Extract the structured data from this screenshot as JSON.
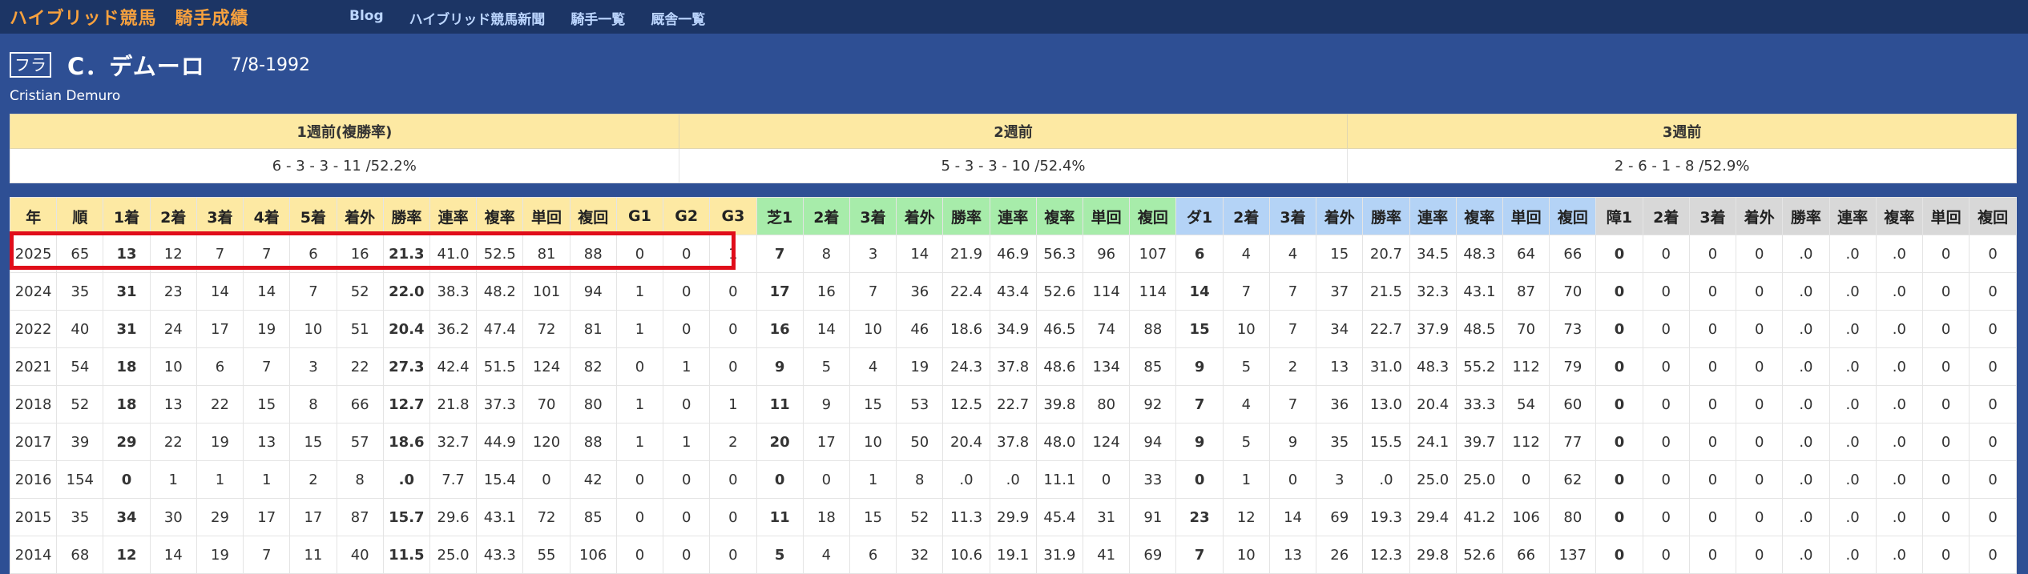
{
  "nav": {
    "site_title": "ハイブリッド競馬　騎手成績",
    "links": [
      "Blog",
      "ハイブリッド競馬新聞",
      "騎手一覧",
      "厩舎一覧"
    ]
  },
  "jockey": {
    "badge": "フラ",
    "name": "C．デムーロ",
    "date": "7/8-1992",
    "english_name": "Cristian Demuro"
  },
  "recent_weeks": {
    "headers": [
      "1週前(複勝率)",
      "2週前",
      "3週前"
    ],
    "values": [
      "6 - 3 - 3 - 11 /52.2%",
      "5 - 3 - 3 - 10 /52.4%",
      "2 - 6 - 1 - 8 /52.9%"
    ]
  },
  "stats_table": {
    "headers": [
      "年",
      "順",
      "1着",
      "2着",
      "3着",
      "4着",
      "5着",
      "着外",
      "勝率",
      "連率",
      "複率",
      "単回",
      "複回",
      "G1",
      "G2",
      "G3",
      "芝1",
      "2着",
      "3着",
      "着外",
      "勝率",
      "連率",
      "複率",
      "単回",
      "複回",
      "ダ1",
      "2着",
      "3着",
      "着外",
      "勝率",
      "連率",
      "複率",
      "単回",
      "複回",
      "障1",
      "2着",
      "3着",
      "着外",
      "勝率",
      "連率",
      "複率",
      "単回",
      "複回"
    ],
    "rows": [
      [
        "2025",
        "65",
        "13",
        "12",
        "7",
        "7",
        "6",
        "16",
        "21.3",
        "41.0",
        "52.5",
        "81",
        "88",
        "0",
        "0",
        "1",
        "7",
        "8",
        "3",
        "14",
        "21.9",
        "46.9",
        "56.3",
        "96",
        "107",
        "6",
        "4",
        "4",
        "15",
        "20.7",
        "34.5",
        "48.3",
        "64",
        "66",
        "0",
        "0",
        "0",
        "0",
        ".0",
        ".0",
        ".0",
        "0",
        "0"
      ],
      [
        "2024",
        "35",
        "31",
        "23",
        "14",
        "14",
        "7",
        "52",
        "22.0",
        "38.3",
        "48.2",
        "101",
        "94",
        "1",
        "0",
        "0",
        "17",
        "16",
        "7",
        "36",
        "22.4",
        "43.4",
        "52.6",
        "114",
        "114",
        "14",
        "7",
        "7",
        "37",
        "21.5",
        "32.3",
        "43.1",
        "87",
        "70",
        "0",
        "0",
        "0",
        "0",
        ".0",
        ".0",
        ".0",
        "0",
        "0"
      ],
      [
        "2022",
        "40",
        "31",
        "24",
        "17",
        "19",
        "10",
        "51",
        "20.4",
        "36.2",
        "47.4",
        "72",
        "81",
        "1",
        "0",
        "0",
        "16",
        "14",
        "10",
        "46",
        "18.6",
        "34.9",
        "46.5",
        "74",
        "88",
        "15",
        "10",
        "7",
        "34",
        "22.7",
        "37.9",
        "48.5",
        "70",
        "73",
        "0",
        "0",
        "0",
        "0",
        ".0",
        ".0",
        ".0",
        "0",
        "0"
      ],
      [
        "2021",
        "54",
        "18",
        "10",
        "6",
        "7",
        "3",
        "22",
        "27.3",
        "42.4",
        "51.5",
        "124",
        "82",
        "0",
        "1",
        "0",
        "9",
        "5",
        "4",
        "19",
        "24.3",
        "37.8",
        "48.6",
        "134",
        "85",
        "9",
        "5",
        "2",
        "13",
        "31.0",
        "48.3",
        "55.2",
        "112",
        "79",
        "0",
        "0",
        "0",
        "0",
        ".0",
        ".0",
        ".0",
        "0",
        "0"
      ],
      [
        "2018",
        "52",
        "18",
        "13",
        "22",
        "15",
        "8",
        "66",
        "12.7",
        "21.8",
        "37.3",
        "70",
        "80",
        "1",
        "0",
        "1",
        "11",
        "9",
        "15",
        "53",
        "12.5",
        "22.7",
        "39.8",
        "80",
        "92",
        "7",
        "4",
        "7",
        "36",
        "13.0",
        "20.4",
        "33.3",
        "54",
        "60",
        "0",
        "0",
        "0",
        "0",
        ".0",
        ".0",
        ".0",
        "0",
        "0"
      ],
      [
        "2017",
        "39",
        "29",
        "22",
        "19",
        "13",
        "15",
        "57",
        "18.6",
        "32.7",
        "44.9",
        "120",
        "88",
        "1",
        "1",
        "2",
        "20",
        "17",
        "10",
        "50",
        "20.4",
        "37.8",
        "48.0",
        "124",
        "94",
        "9",
        "5",
        "9",
        "35",
        "15.5",
        "24.1",
        "39.7",
        "112",
        "77",
        "0",
        "0",
        "0",
        "0",
        ".0",
        ".0",
        ".0",
        "0",
        "0"
      ],
      [
        "2016",
        "154",
        "0",
        "1",
        "1",
        "1",
        "2",
        "8",
        ".0",
        "7.7",
        "15.4",
        "0",
        "42",
        "0",
        "0",
        "0",
        "0",
        "0",
        "1",
        "8",
        ".0",
        ".0",
        "11.1",
        "0",
        "33",
        "0",
        "1",
        "0",
        "3",
        ".0",
        "25.0",
        "25.0",
        "0",
        "62",
        "0",
        "0",
        "0",
        "0",
        ".0",
        ".0",
        ".0",
        "0",
        "0"
      ],
      [
        "2015",
        "35",
        "34",
        "30",
        "29",
        "17",
        "17",
        "87",
        "15.7",
        "29.6",
        "43.1",
        "72",
        "85",
        "0",
        "0",
        "0",
        "11",
        "18",
        "15",
        "52",
        "11.3",
        "29.9",
        "45.4",
        "31",
        "91",
        "23",
        "12",
        "14",
        "69",
        "19.3",
        "29.4",
        "41.2",
        "106",
        "80",
        "0",
        "0",
        "0",
        "0",
        ".0",
        ".0",
        ".0",
        "0",
        "0"
      ],
      [
        "2014",
        "68",
        "12",
        "14",
        "19",
        "7",
        "11",
        "40",
        "11.5",
        "25.0",
        "43.3",
        "55",
        "106",
        "0",
        "0",
        "0",
        "5",
        "4",
        "6",
        "32",
        "10.6",
        "19.1",
        "31.9",
        "41",
        "69",
        "7",
        "10",
        "13",
        "26",
        "12.3",
        "29.8",
        "52.6",
        "66",
        "137",
        "0",
        "0",
        "0",
        "0",
        ".0",
        ".0",
        ".0",
        "0",
        "0"
      ]
    ]
  }
}
